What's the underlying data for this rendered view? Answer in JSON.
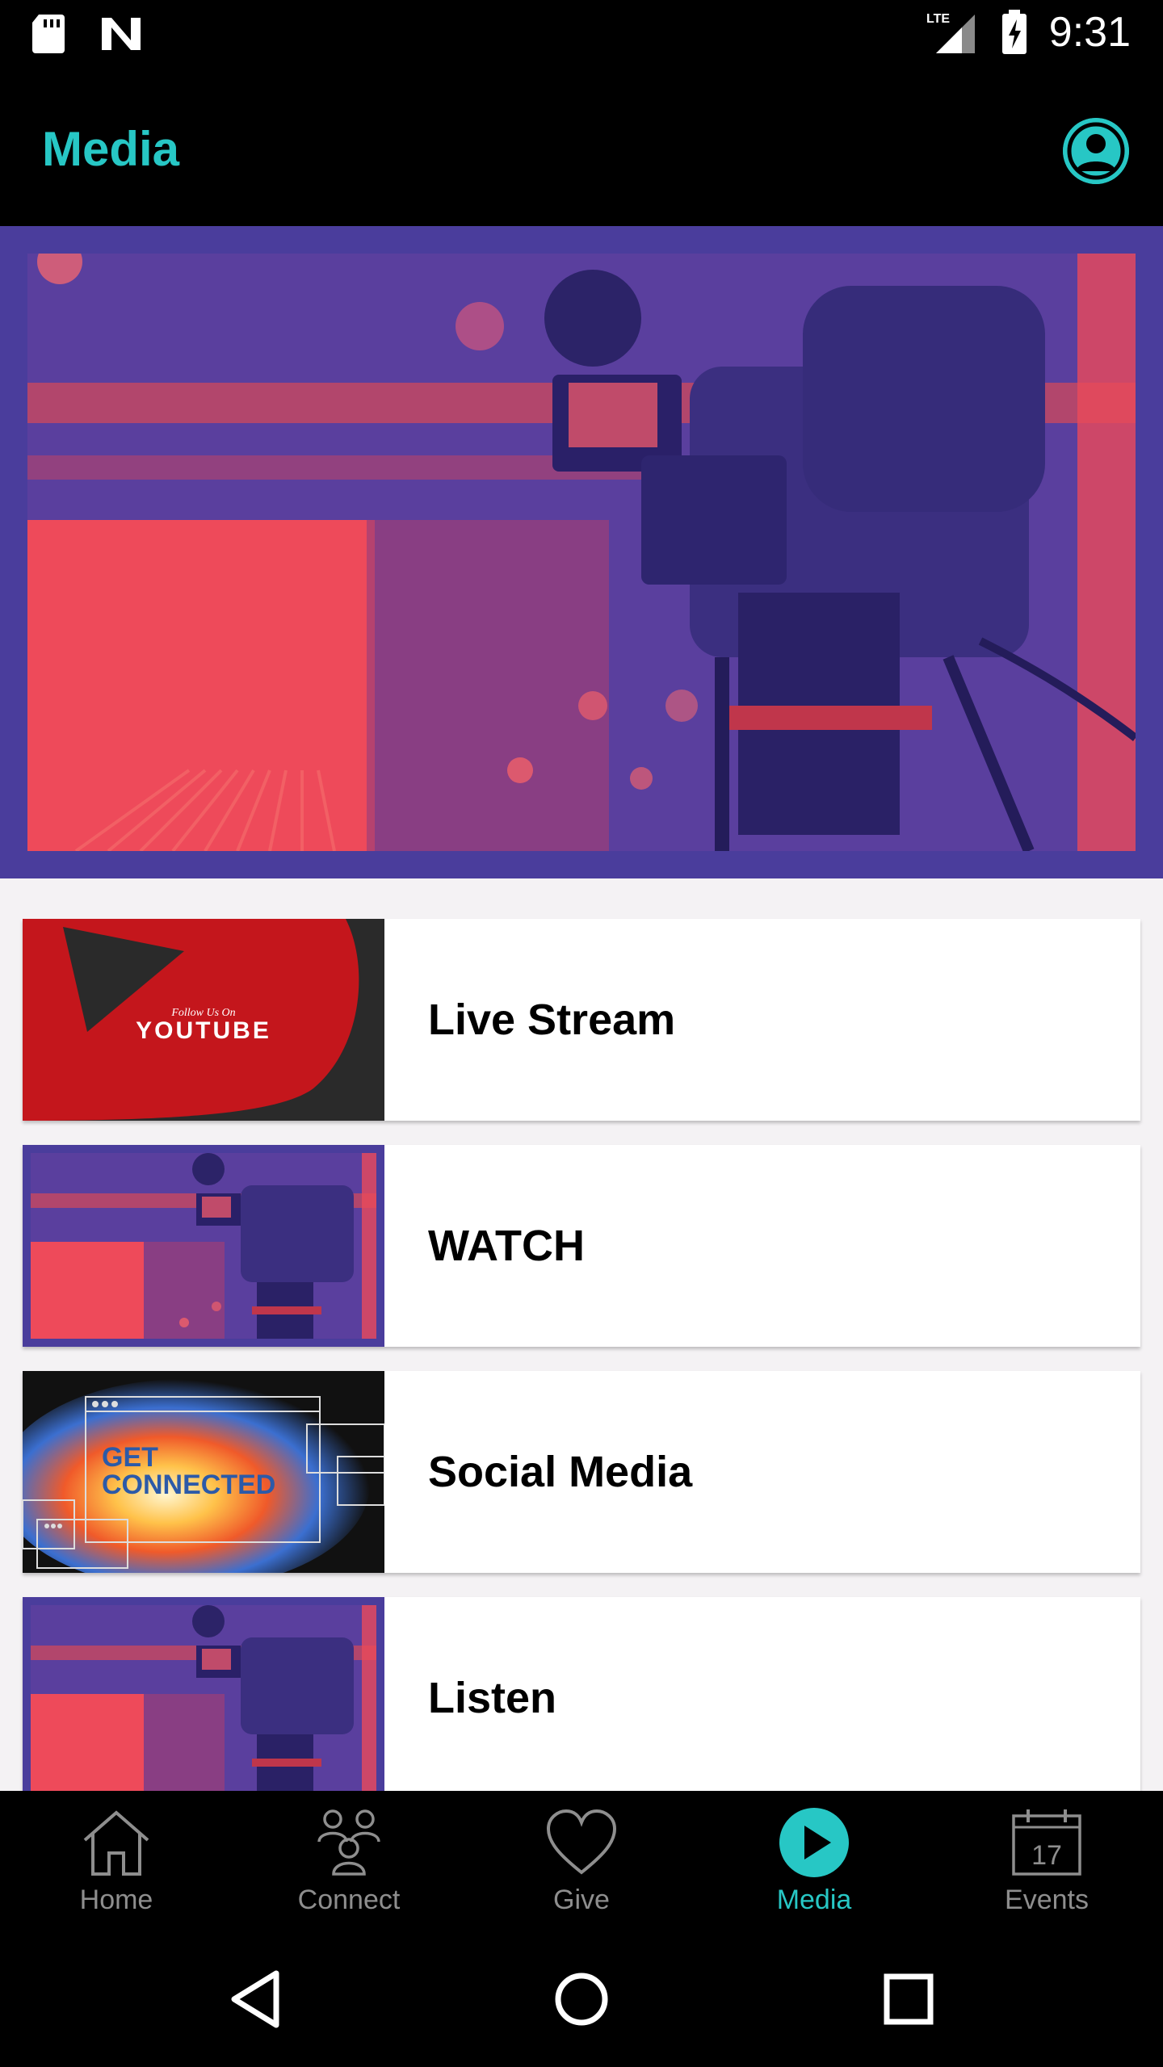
{
  "status_bar": {
    "time": "9:31",
    "network": "LTE",
    "icons": [
      "sd-card-icon",
      "n-notification-icon",
      "lte-signal-icon",
      "battery-charging-icon"
    ]
  },
  "app_bar": {
    "title": "Media",
    "profile_icon": "account-circle-icon"
  },
  "colors": {
    "accent": "#27c7c5",
    "hero_purple": "#4a3d9c",
    "hero_red": "#f0485a"
  },
  "media_items": [
    {
      "label": "Live Stream",
      "thumb": "youtube",
      "thumb_text_small": "Follow Us On",
      "thumb_text_big": "YOUTUBE"
    },
    {
      "label": "WATCH",
      "thumb": "camera"
    },
    {
      "label": "Social Media",
      "thumb": "get-connected",
      "thumb_text_1": "GET",
      "thumb_text_2": "CONNECTED"
    },
    {
      "label": "Listen",
      "thumb": "camera"
    }
  ],
  "bottom_nav": {
    "items": [
      {
        "label": "Home",
        "icon": "home-icon"
      },
      {
        "label": "Connect",
        "icon": "people-icon"
      },
      {
        "label": "Give",
        "icon": "heart-icon"
      },
      {
        "label": "Media",
        "icon": "play-circle-icon",
        "active": true
      },
      {
        "label": "Events",
        "icon": "calendar-icon",
        "day": "17"
      }
    ]
  },
  "system_nav": [
    "back-icon",
    "home-circle-icon",
    "recents-icon"
  ]
}
